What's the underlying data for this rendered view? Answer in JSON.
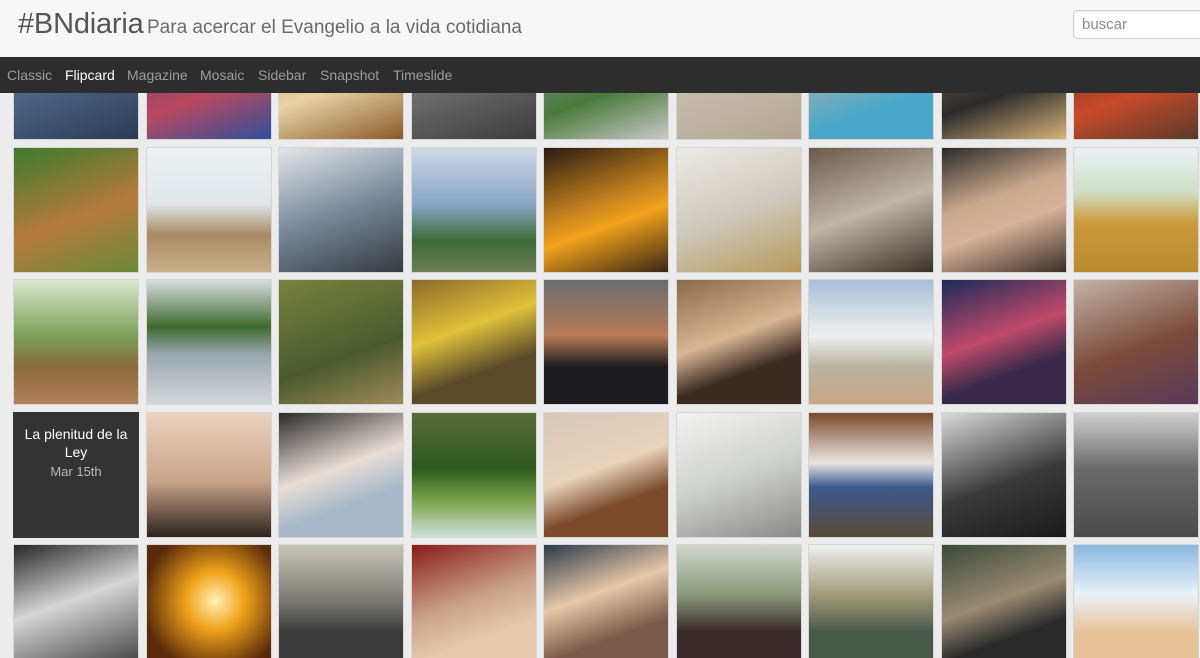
{
  "header": {
    "brand": "#BNdiaria",
    "tagline": "Para acercar el Evangelio a la vida cotidiana",
    "search_placeholder": "buscar"
  },
  "nav": {
    "items": [
      {
        "label": "Classic",
        "active": false
      },
      {
        "label": "Flipcard",
        "active": true
      },
      {
        "label": "Magazine",
        "active": false
      },
      {
        "label": "Mosaic",
        "active": false
      },
      {
        "label": "Sidebar",
        "active": false
      },
      {
        "label": "Snapshot",
        "active": false
      },
      {
        "label": "Timeslide",
        "active": false
      }
    ]
  },
  "grid": {
    "card": {
      "title": "La plenitud de la Ley",
      "date": "Mar 15th"
    },
    "photo_tile_tint_codes": [
      [
        "a",
        "b",
        "c",
        "d",
        "e",
        "f",
        "g",
        "h",
        "i"
      ],
      [
        "j",
        "k",
        "l",
        "m",
        "n",
        "o",
        "p",
        "q",
        "r"
      ],
      [
        "s",
        "t",
        "u",
        "v",
        "w",
        "x",
        "y",
        "z",
        "aa"
      ],
      [
        "card",
        "bb",
        "cc",
        "dd",
        "ee",
        "ff",
        "gg",
        "hh",
        "ii"
      ],
      [
        "jj",
        "kk",
        "ll",
        "mm",
        "nn",
        "oo",
        "pp",
        "qq",
        "rr"
      ]
    ]
  }
}
